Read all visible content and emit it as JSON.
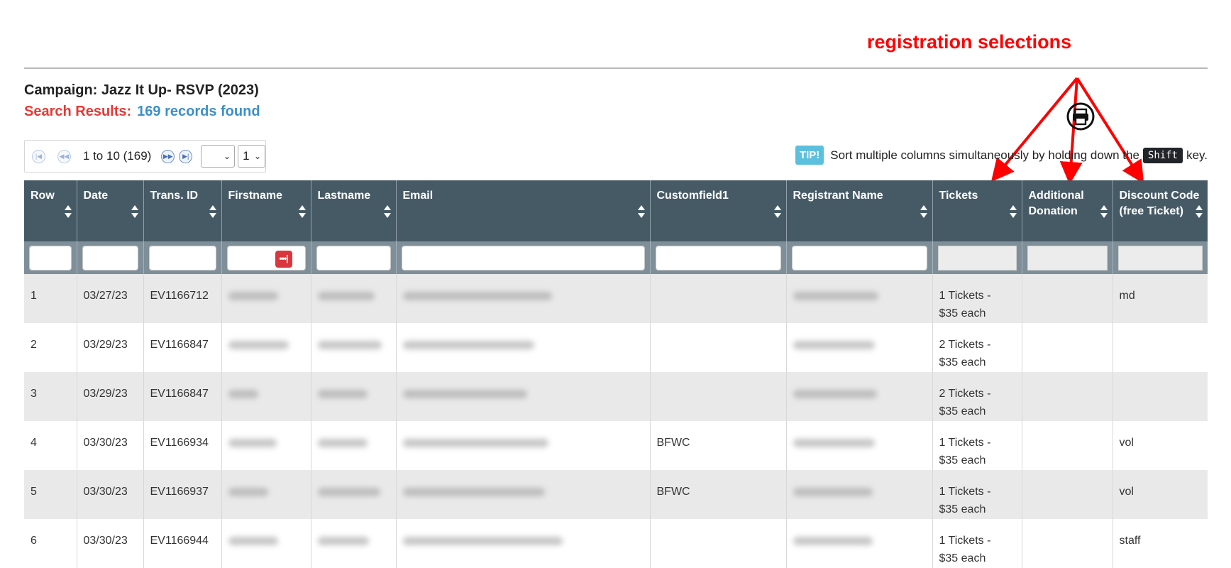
{
  "annotation": {
    "title": "registration selections",
    "color": "#ff0000"
  },
  "campaign": "Campaign: Jazz It Up- RSVP (2023)",
  "search": {
    "label": "Search Results:",
    "count": "169 records found"
  },
  "pager": {
    "range": "1 to 10 (169)",
    "page_size": "",
    "page": "1"
  },
  "tip": {
    "badge": "TIP!",
    "before": "Sort multiple columns simultaneously by holding down the",
    "key": "Shift",
    "after": "key."
  },
  "columns": [
    "Row",
    "Date",
    "Trans. ID",
    "Firstname",
    "Lastname",
    "Email",
    "Customfield1",
    "Registrant Name",
    "Tickets",
    "Additional Donation",
    "Discount Code (free Ticket)"
  ],
  "rows": [
    {
      "row": "1",
      "date": "03/27/23",
      "trans": "EV1166712",
      "custom": "",
      "tickets": [
        "1 Tickets -",
        "$35 each"
      ],
      "donation": "",
      "discount": "md"
    },
    {
      "row": "2",
      "date": "03/29/23",
      "trans": "EV1166847",
      "custom": "",
      "tickets": [
        "2 Tickets -",
        "$35 each"
      ],
      "donation": "",
      "discount": ""
    },
    {
      "row": "3",
      "date": "03/29/23",
      "trans": "EV1166847",
      "custom": "",
      "tickets": [
        "2 Tickets -",
        "$35 each"
      ],
      "donation": "",
      "discount": ""
    },
    {
      "row": "4",
      "date": "03/30/23",
      "trans": "EV1166934",
      "custom": "BFWC",
      "tickets": [
        "1 Tickets -",
        "$35 each"
      ],
      "donation": "",
      "discount": "vol"
    },
    {
      "row": "5",
      "date": "03/30/23",
      "trans": "EV1166937",
      "custom": "BFWC",
      "tickets": [
        "1 Tickets -",
        "$35 each"
      ],
      "donation": "",
      "discount": "vol"
    },
    {
      "row": "6",
      "date": "03/30/23",
      "trans": "EV1166944",
      "custom": "",
      "tickets": [
        "1 Tickets -",
        "$35 each"
      ],
      "donation": "",
      "discount": "staff"
    }
  ],
  "colors": {
    "header_bg": "#465a66",
    "filter_bg": "#7f8f99",
    "row_alt": "#e9e9e9",
    "search_label": "#e53935",
    "search_count": "#3d8fc9"
  }
}
